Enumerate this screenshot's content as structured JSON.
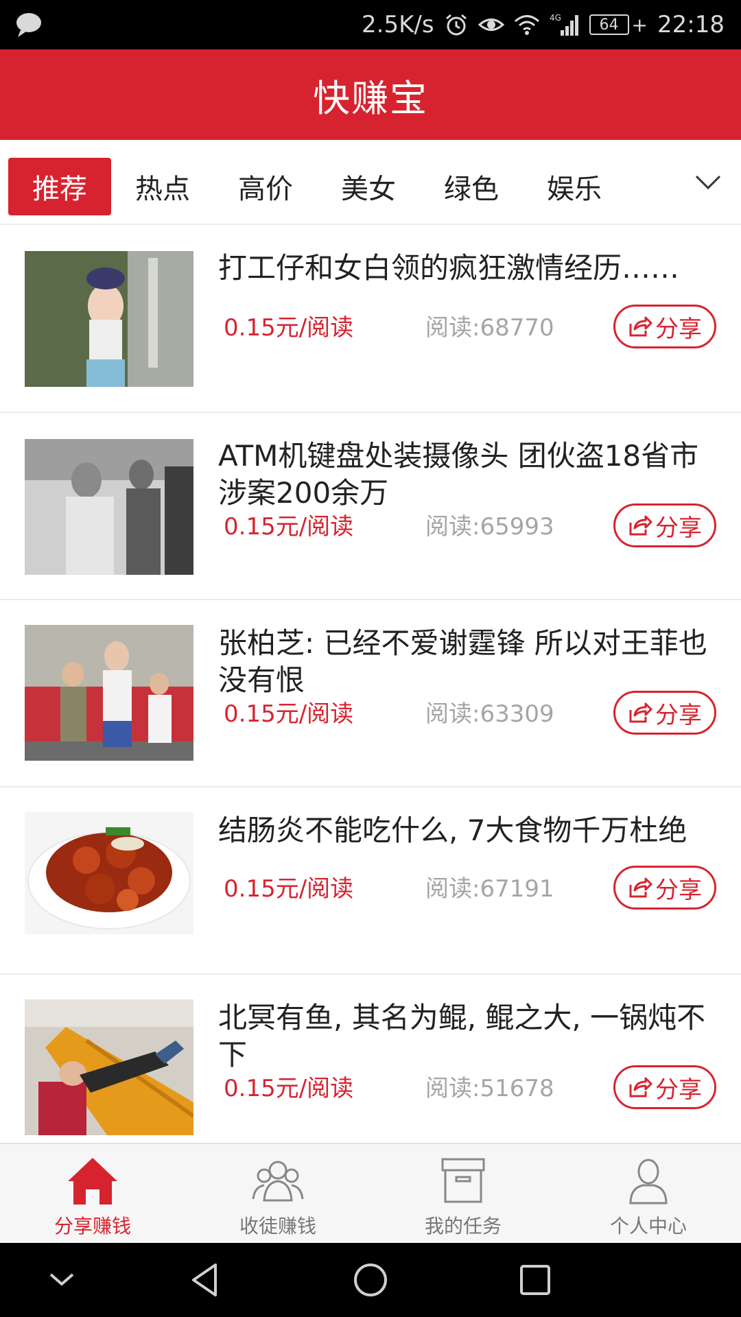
{
  "status_bar": {
    "net_speed": "2.5K/s",
    "battery": "64",
    "time": "22:18",
    "network": "4G"
  },
  "app": {
    "title": "快赚宝"
  },
  "tabs": [
    {
      "label": "推荐",
      "active": true
    },
    {
      "label": "热点",
      "active": false
    },
    {
      "label": "高价",
      "active": false
    },
    {
      "label": "美女",
      "active": false
    },
    {
      "label": "绿色",
      "active": false
    },
    {
      "label": "娱乐",
      "active": false
    }
  ],
  "news": [
    {
      "title": "打工仔和女白领的疯狂激情经历……",
      "price": "0.15元/阅读",
      "reads": "阅读:68770",
      "share": "分享"
    },
    {
      "title": "ATM机键盘处装摄像头 团伙盗18省市涉案200余万",
      "price": "0.15元/阅读",
      "reads": "阅读:65993",
      "share": "分享"
    },
    {
      "title": "张柏芝: 已经不爱谢霆锋 所以对王菲也没有恨",
      "price": "0.15元/阅读",
      "reads": "阅读:63309",
      "share": "分享"
    },
    {
      "title": "结肠炎不能吃什么, 7大食物千万杜绝",
      "price": "0.15元/阅读",
      "reads": "阅读:67191",
      "share": "分享"
    },
    {
      "title": "北冥有鱼, 其名为鲲, 鲲之大, 一锅炖不下",
      "price": "0.15元/阅读",
      "reads": "阅读:51678",
      "share": "分享"
    }
  ],
  "bottom_nav": [
    {
      "label": "分享赚钱",
      "icon": "home-icon",
      "active": true
    },
    {
      "label": "收徒赚钱",
      "icon": "people-icon",
      "active": false
    },
    {
      "label": "我的任务",
      "icon": "box-icon",
      "active": false
    },
    {
      "label": "个人中心",
      "icon": "person-icon",
      "active": false
    }
  ],
  "colors": {
    "accent": "#d7232f",
    "muted": "#a5a5a5"
  }
}
